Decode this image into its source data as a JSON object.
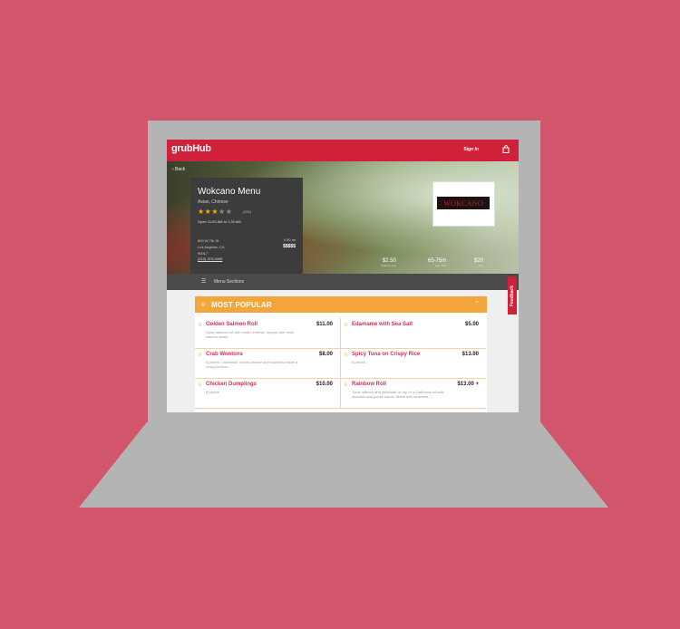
{
  "header": {
    "logo": "grubHub",
    "signin": "Sign In",
    "bag_icon": "bag-icon"
  },
  "hero": {
    "back": "‹ Back"
  },
  "restaurant": {
    "title": "Wokcano Menu",
    "cuisine": "Asian, Chinese",
    "rating": 3,
    "rating_count": "(231)",
    "hours": "Open 11:00 AM to 1:30 AM",
    "address_line1": "800 W 7th St",
    "address_line2": "Los Angeles, CA",
    "address_line3": "90017",
    "phone": "(213) 375-0055",
    "distance": "0.90 mi",
    "price": "$$$$$",
    "logo_text": "WOKCANO"
  },
  "stats": [
    {
      "value": "$2.50",
      "label": "Delivery Fee"
    },
    {
      "value": "65-75m",
      "label": "Est. Wait"
    },
    {
      "value": "$20",
      "label": "Min"
    }
  ],
  "sections_bar": {
    "label": "Menu Sections"
  },
  "menu": {
    "title": "MOST POPULAR",
    "items": [
      {
        "name": "Golden Salmon Roll",
        "price": "$11.00",
        "desc": "Spicy salmon roll with cream cheese, topped with fresh salmon slices."
      },
      {
        "name": "Edamame with Sea Salt",
        "price": "$5.00",
        "desc": ""
      },
      {
        "name": "Crab Wontons",
        "price": "$8.00",
        "desc": "6 pieces. Crabmeat, cream cheese and scallions inside a crispy wonton."
      },
      {
        "name": "Spicy Tuna on Crispy Rice",
        "price": "$13.00",
        "desc": "6 pieces."
      },
      {
        "name": "Chicken Dumplings",
        "price": "$10.00",
        "desc": "6 pieces."
      },
      {
        "name": "Rainbow Roll",
        "price": "$13.00 +",
        "desc": "Tuna, salmon and yellowtail on top of a California roll with avocado and ponzu sauce. Made with seaweed."
      }
    ]
  },
  "feedback": "Feedback"
}
